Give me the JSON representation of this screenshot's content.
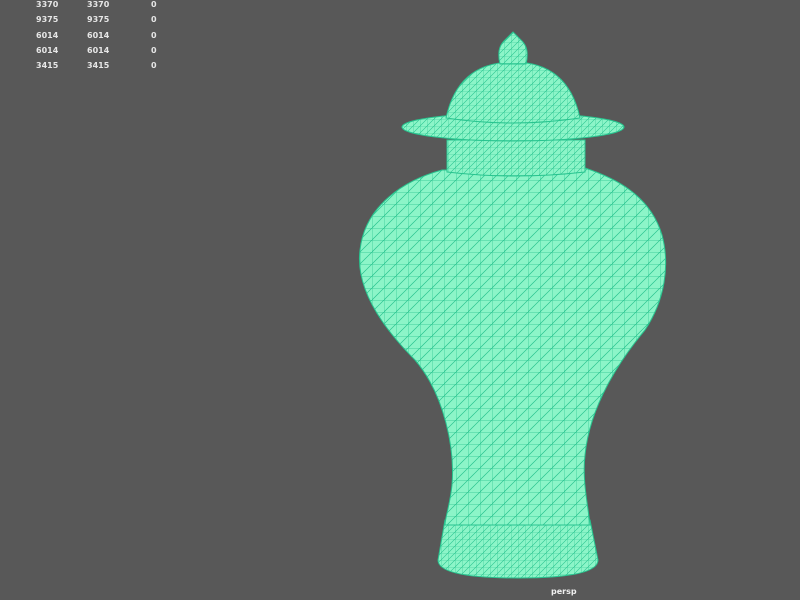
{
  "viewport": {
    "camera_label": "persp",
    "background_color": "#585858",
    "wire_color": "#8cf5c8",
    "wire_line_color": "#28c48f"
  },
  "hud": {
    "rows": [
      {
        "a": "3370",
        "b": "3370",
        "c": "0"
      },
      {
        "a": "9375",
        "b": "9375",
        "c": "0"
      },
      {
        "a": "6014",
        "b": "6014",
        "c": "0"
      },
      {
        "a": "6014",
        "b": "6014",
        "c": "0"
      },
      {
        "a": "3415",
        "b": "3415",
        "c": "0"
      }
    ]
  }
}
